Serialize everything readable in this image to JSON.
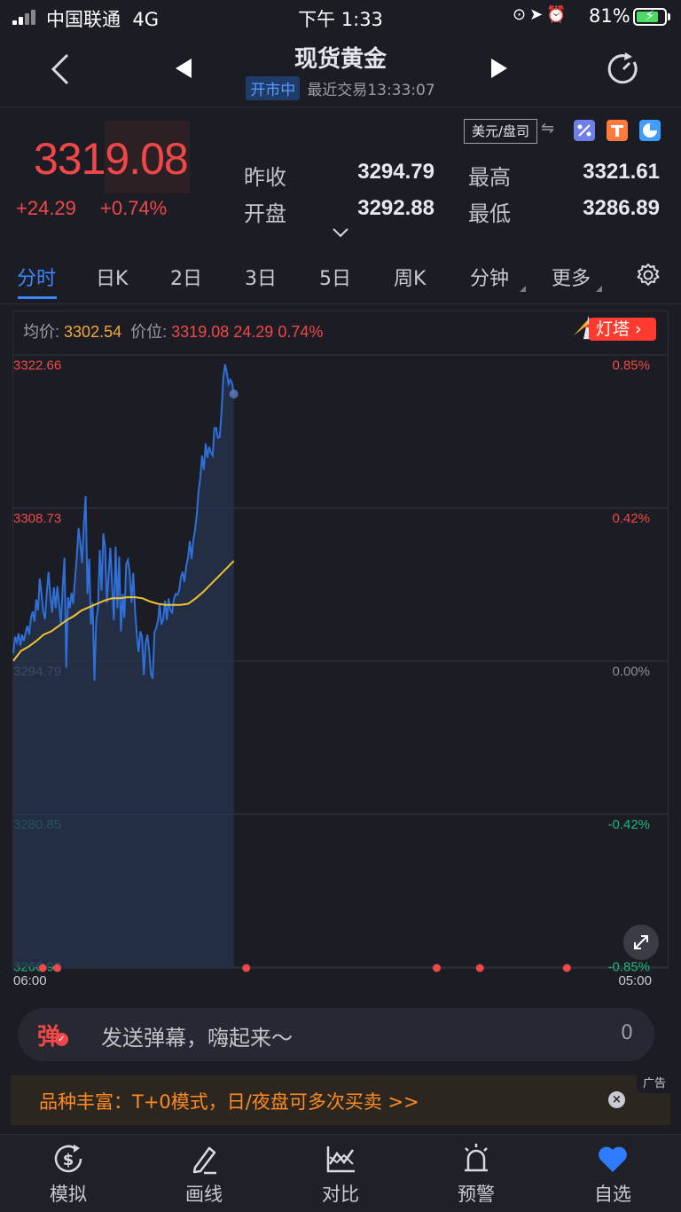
{
  "status_bar": {
    "carrier": "中国联通",
    "network": "4G",
    "time": "下午 1:33",
    "battery": "81%",
    "battery_level": 0.81
  },
  "header": {
    "title": "现货黄金",
    "status_badge": "开市中",
    "last_trade": "最近交易13:33:07"
  },
  "quote": {
    "price": "3319.08",
    "change": "+24.29",
    "change_pct": "+0.74%",
    "currency_toggle": "美元/盘司",
    "fields": [
      {
        "label": "昨收",
        "value": "3294.79"
      },
      {
        "label": "最高",
        "value": "3321.61"
      },
      {
        "label": "开盘",
        "value": "3292.88"
      },
      {
        "label": "最低",
        "value": "3286.89"
      }
    ]
  },
  "tabs": [
    {
      "label": "分时",
      "active": true
    },
    {
      "label": "日K"
    },
    {
      "label": "2日"
    },
    {
      "label": "3日"
    },
    {
      "label": "5日"
    },
    {
      "label": "周K"
    },
    {
      "label": "分钟"
    },
    {
      "label": "更多"
    }
  ],
  "chart_info": {
    "avg_label": "均价:",
    "avg_value": "3302.54",
    "price_label": "价位:",
    "price_value": "3319.08",
    "change_value": "24.29",
    "change_pct": "0.74%",
    "lighthouse_button": "灯塔"
  },
  "chart_data": {
    "type": "line",
    "ylim": [
      3266.92,
      3322.66
    ],
    "y_ticks_left": [
      "3322.66",
      "3308.73",
      "3294.79",
      "3280.85",
      "3266.92"
    ],
    "y_ticks_right": [
      "0.85%",
      "0.42%",
      "0.00%",
      "-0.42%",
      "-0.85%"
    ],
    "x_ticks": [
      "06:00",
      "05:00"
    ],
    "session_fraction": 0.337,
    "series": [
      {
        "role": "price",
        "color": "#2f6fd8",
        "values": [
          3295.5,
          3297.0,
          3296.5,
          3297.3,
          3296.2,
          3297.2,
          3296.6,
          3297.4,
          3298.0,
          3297.2,
          3298.7,
          3299.3,
          3298.4,
          3300.4,
          3299.4,
          3302.3,
          3300.9,
          3299.3,
          3298.6,
          3301.1,
          3302.9,
          3300.7,
          3299.2,
          3301.5,
          3299.6,
          3301.6,
          3299.9,
          3298.2,
          3301.5,
          3304.2,
          3294.2,
          3300.6,
          3299.6,
          3301.0,
          3300.0,
          3302.3,
          3304.2,
          3306.9,
          3305.5,
          3303.7,
          3307.3,
          3309.8,
          3300.9,
          3304.1,
          3298.1,
          3300.1,
          3293.0,
          3298.5,
          3299.6,
          3304.9,
          3301.2,
          3306.4,
          3305.2,
          3300.1,
          3302.4,
          3305.1,
          3301.8,
          3298.5,
          3305.2,
          3299.6,
          3304.3,
          3297.5,
          3300.9,
          3298.7,
          3303.6,
          3304.0,
          3302.8,
          3300.1,
          3302.8,
          3299.4,
          3297.2,
          3295.6,
          3297.5,
          3297.0,
          3293.5,
          3296.4,
          3297.2,
          3295.7,
          3293.6,
          3293.2,
          3297.4,
          3297.8,
          3298.5,
          3300.0,
          3298.1,
          3298.6,
          3300.3,
          3298.5,
          3300.5,
          3299.4,
          3299.2,
          3300.4,
          3300.9,
          3300.8,
          3301.2,
          3302.4,
          3302.9,
          3302.0,
          3303.4,
          3304.2,
          3305.7,
          3304.1,
          3305.7,
          3306.7,
          3308.1,
          3310.2,
          3311.5,
          3313.5,
          3312.2,
          3314.6,
          3313.3,
          3314.3,
          3313.8,
          3313.5,
          3316.0,
          3316.0,
          3315.1,
          3315.2,
          3317.4,
          3320.5,
          3321.8,
          3321.1,
          3320.0,
          3320.4,
          3320.1,
          3319.1
        ]
      },
      {
        "role": "average",
        "color": "#f2c22e",
        "values": [
          3294.8,
          3295.7,
          3296.1,
          3296.6,
          3297.2,
          3297.5,
          3298.0,
          3298.5,
          3298.9,
          3299.4,
          3299.7,
          3300.0,
          3300.3,
          3300.5,
          3300.5,
          3300.6,
          3300.6,
          3300.5,
          3300.2,
          3300.0,
          3299.9,
          3299.9,
          3299.9,
          3300.0,
          3300.5,
          3301.1,
          3301.8,
          3302.5,
          3303.2,
          3303.9
        ]
      }
    ],
    "markers_x_fraction": [
      0.045,
      0.067,
      0.356,
      0.647,
      0.713,
      0.846
    ]
  },
  "danmu": {
    "icon_text": "弹",
    "placeholder": "发送弹幕，嗨起来～",
    "count": "0"
  },
  "ad": {
    "text": "品种丰富：T+0模式，日/夜盘可多次买卖 >>",
    "tag": "广告"
  },
  "bottom_nav": [
    {
      "label": "模拟",
      "icon": "simulate-icon"
    },
    {
      "label": "画线",
      "icon": "draw-line-icon"
    },
    {
      "label": "对比",
      "icon": "compare-icon"
    },
    {
      "label": "预警",
      "icon": "alarm-icon"
    },
    {
      "label": "自选",
      "icon": "heart-icon",
      "active": true
    }
  ],
  "colors": {
    "up": "#f04848",
    "down": "#1bb67c",
    "accent": "#3a86ff",
    "price_line": "#2f6fd8",
    "avg_line": "#f2c22e",
    "ad_text": "#ff8a1f"
  }
}
